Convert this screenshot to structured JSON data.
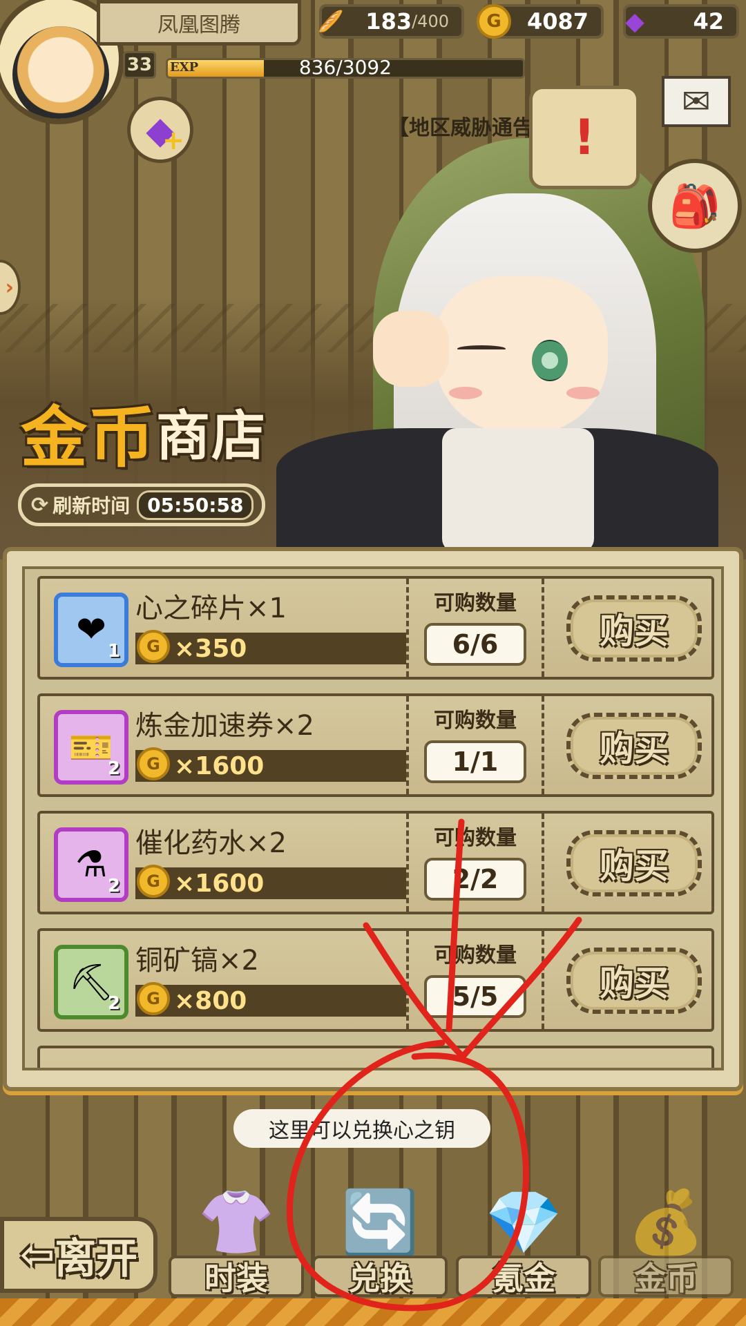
{
  "header": {
    "player_name": "凤凰图腾",
    "level": "33",
    "exp_tag": "EXP",
    "exp_text": "836/3092",
    "exp_fraction": 0.27,
    "bread": {
      "value": "183",
      "max": "/400"
    },
    "gold": "4087",
    "gems": "42"
  },
  "notice": {
    "label": "【地区威胁通告"
  },
  "shop": {
    "title_gold": "金币",
    "title_rest": "商店",
    "refresh_label": "刷新时间",
    "refresh_time": "05:50:58",
    "qty_label": "可购数量",
    "buy_label": "购买",
    "items": [
      {
        "name": "心之碎片×1",
        "price": "×350",
        "qty": "6/6",
        "count": "1",
        "icon": "heart-shard-icon",
        "frame": "blue"
      },
      {
        "name": "炼金加速券×2",
        "price": "×1600",
        "qty": "1/1",
        "count": "2",
        "icon": "alchemy-ticket-icon",
        "frame": "purple"
      },
      {
        "name": "催化药水×2",
        "price": "×1600",
        "qty": "2/2",
        "count": "2",
        "icon": "catalyst-potion-icon",
        "frame": "purple"
      },
      {
        "name": "铜矿镐×2",
        "price": "×800",
        "qty": "5/5",
        "count": "2",
        "icon": "copper-pickaxe-icon",
        "frame": "green"
      }
    ]
  },
  "tooltip": "这里可以兑换心之钥",
  "nav": {
    "leave": "离开",
    "tabs": [
      {
        "label": "时装",
        "icon": "costume-icon"
      },
      {
        "label": "兑换",
        "icon": "exchange-bag-icon"
      },
      {
        "label": "氪金",
        "icon": "gem-bag-icon"
      },
      {
        "label": "金币",
        "icon": "gold-bag-icon",
        "active": true
      }
    ]
  },
  "colors": {
    "gold_accent": "#f5b320",
    "annotation_red": "#e0241b",
    "panel_bg": "#e2d6b1"
  }
}
